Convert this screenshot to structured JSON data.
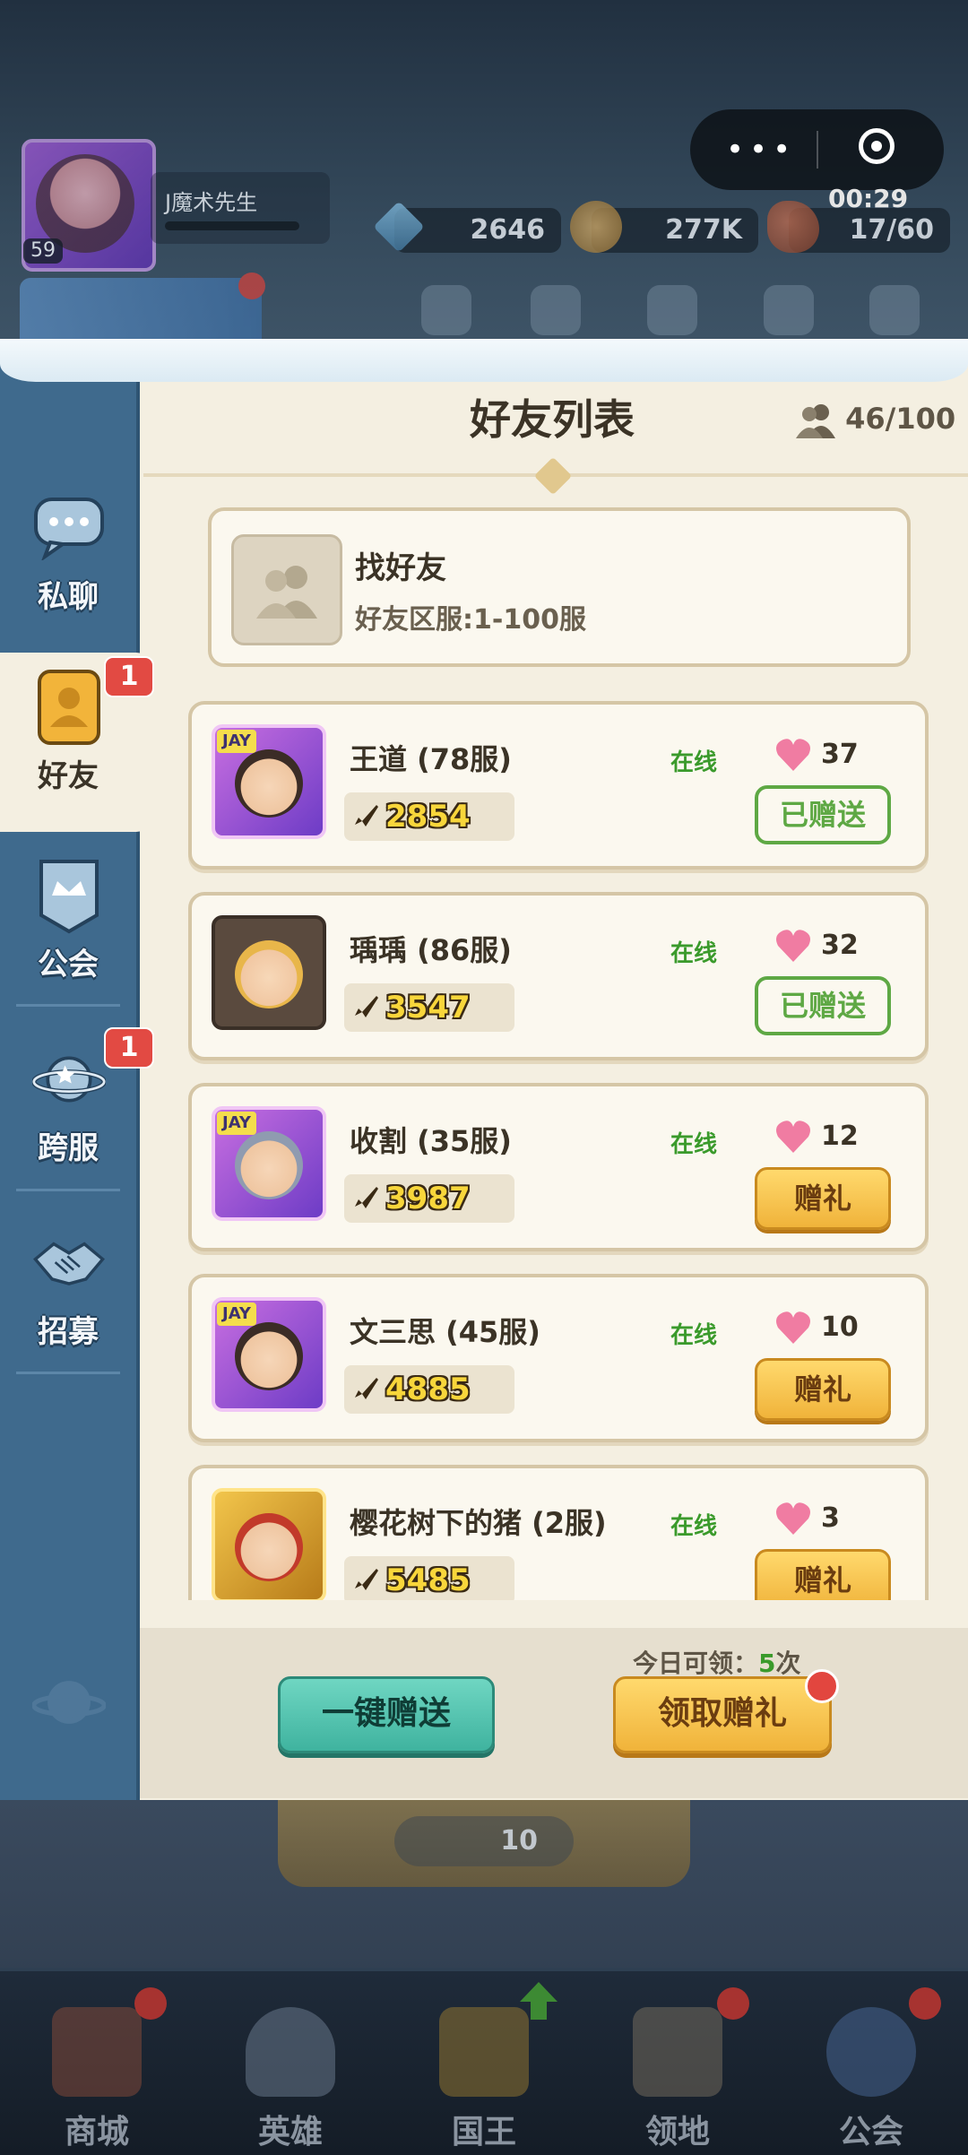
{
  "header": {
    "player_name": "J魔术先生",
    "player_level": "59",
    "gems": "2646",
    "coins": "277K",
    "stamina": "17/60",
    "timer": "00:29",
    "more_icon": "ellipsis-icon",
    "close_icon": "target-close-icon"
  },
  "sidebar": {
    "items": [
      {
        "label": "私聊",
        "icon": "chat-bubble-icon"
      },
      {
        "label": "好友",
        "icon": "friend-card-icon",
        "badge": "1"
      },
      {
        "label": "公会",
        "icon": "guild-banner-icon"
      },
      {
        "label": "跨服",
        "icon": "planet-icon",
        "badge": "1"
      },
      {
        "label": "招募",
        "icon": "handshake-icon"
      }
    ]
  },
  "panel": {
    "title": "好友列表",
    "friend_count": "46/100",
    "find": {
      "title": "找好友",
      "subtitle": "好友区服:1-100服"
    }
  },
  "friends": [
    {
      "name": "王道 (78服)",
      "power": "2854",
      "status": "在线",
      "likes": "37",
      "action": "已赠送",
      "gifted": true,
      "frame": "purple"
    },
    {
      "name": "瑀瑀 (86服)",
      "power": "3547",
      "status": "在线",
      "likes": "32",
      "action": "已赠送",
      "gifted": true,
      "frame": "plain"
    },
    {
      "name": "收割 (35服)",
      "power": "3987",
      "status": "在线",
      "likes": "12",
      "action": "赠礼",
      "gifted": false,
      "frame": "purple"
    },
    {
      "name": "文三思 (45服)",
      "power": "4885",
      "status": "在线",
      "likes": "10",
      "action": "赠礼",
      "gifted": false,
      "frame": "purple"
    },
    {
      "name": "樱花树下的猪 (2服)",
      "power": "5485",
      "status": "在线",
      "likes": "3",
      "action": "赠礼",
      "gifted": false,
      "frame": "gold"
    }
  ],
  "frame_tag": "JAY",
  "footer": {
    "send_all": "一键赠送",
    "remain_prefix": "今日可领：",
    "remain_count": "5",
    "remain_suffix": "次",
    "claim": "领取赠礼"
  },
  "bottom": {
    "stamina_cost": "10",
    "nav": [
      {
        "label": "商城",
        "icon": "shop-icon",
        "dot": true
      },
      {
        "label": "英雄",
        "icon": "helmet-icon",
        "dot": false
      },
      {
        "label": "国王",
        "icon": "crown-icon",
        "dot": false,
        "arrow": true
      },
      {
        "label": "领地",
        "icon": "castle-icon",
        "dot": true
      },
      {
        "label": "公会",
        "icon": "guild-planet-icon",
        "dot": true
      }
    ]
  },
  "colors": {
    "online": "#3a9a2b",
    "gold_button": "#f0b33a",
    "teal_button": "#3fb39f",
    "sidebar": "#3f6a8d",
    "badge": "#e24a43"
  }
}
